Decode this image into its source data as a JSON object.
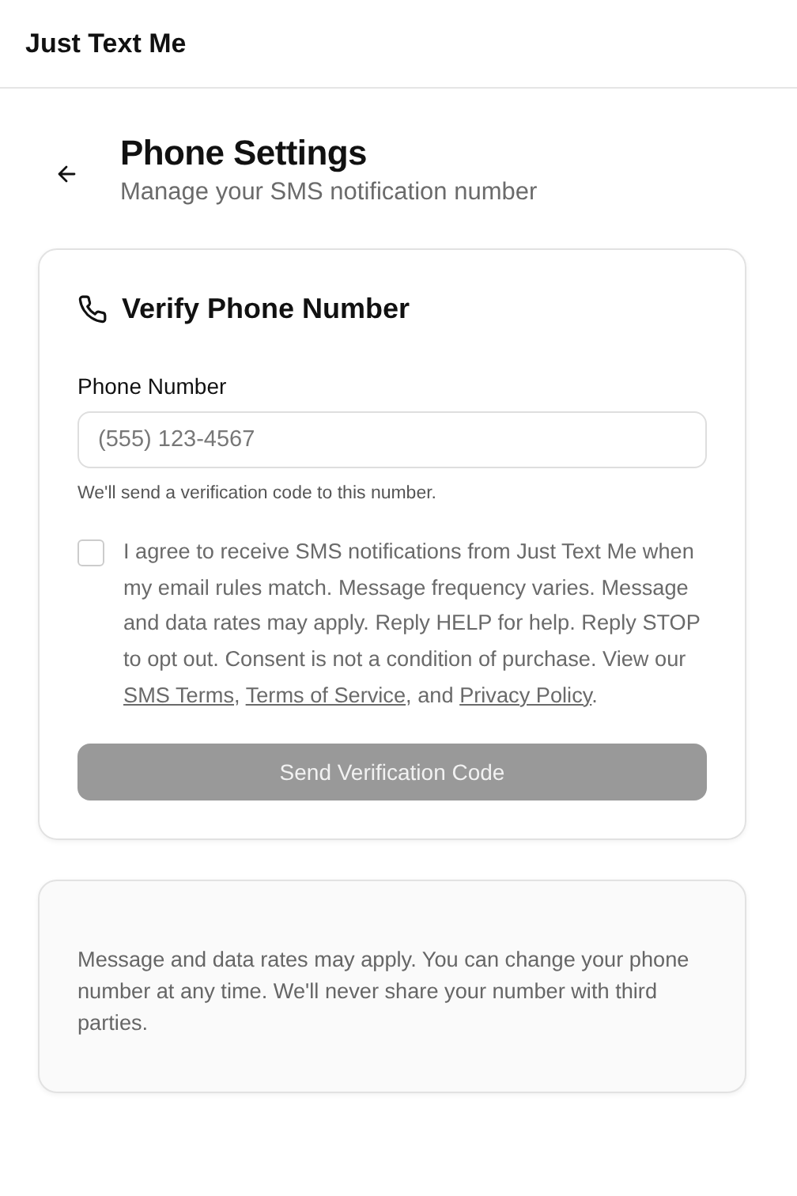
{
  "app_bar": {
    "title": "Just Text Me"
  },
  "page": {
    "title": "Phone Settings",
    "subtitle": "Manage your SMS notification number"
  },
  "verify_card": {
    "title": "Verify Phone Number",
    "phone_field": {
      "label": "Phone Number",
      "placeholder": "(555) 123-4567",
      "hint": "We'll send a verification code to this number."
    },
    "consent": {
      "checked": false,
      "parts": [
        {
          "kind": "text",
          "text": "I agree to receive SMS notifications from Just Text Me when my email rules match. Message frequency varies. Message and data rates may apply. Reply HELP for help. Reply STOP to opt out. Consent is not a condition of purchase. View our "
        },
        {
          "kind": "link",
          "text": "SMS Terms"
        },
        {
          "kind": "text",
          "text": ", "
        },
        {
          "kind": "link",
          "text": "Terms of Service"
        },
        {
          "kind": "text",
          "text": ", and "
        },
        {
          "kind": "link",
          "text": "Privacy Policy"
        },
        {
          "kind": "text",
          "text": "."
        }
      ]
    },
    "submit_button": {
      "label": "Send Verification Code",
      "disabled": true
    }
  },
  "info_card": {
    "text": "Message and data rates may apply. You can change your phone number at any time. We'll never share your number with third parties."
  }
}
